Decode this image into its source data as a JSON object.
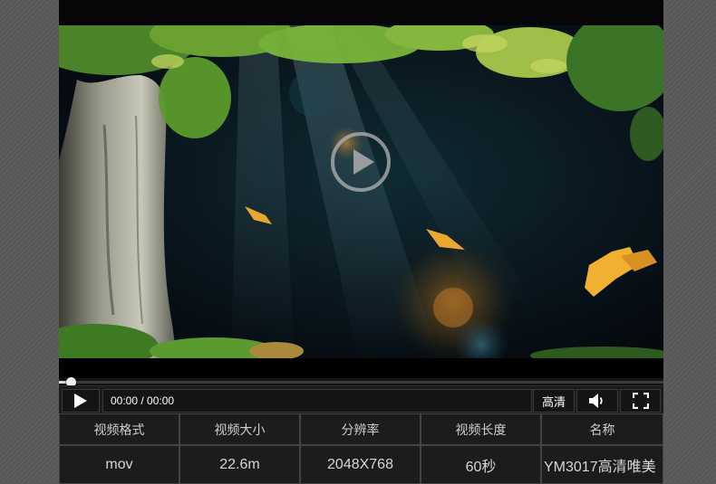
{
  "player": {
    "current_time": "00:00",
    "duration": "00:00",
    "time_display": "00:00 / 00:00",
    "progress": 0.01,
    "quality_label": "高清",
    "icons": {
      "play_overlay": "play-circle-icon",
      "play": "play-icon",
      "volume": "volume-icon",
      "fullscreen": "fullscreen-icon"
    }
  },
  "info_table": {
    "headers": [
      "视频格式",
      "视频大小",
      "分辨率",
      "视频长度",
      "名称"
    ],
    "values": [
      "mov",
      "22.6m",
      "2048X768",
      "60秒",
      "YM3017高清唯美"
    ]
  },
  "colors": {
    "panel_bg": "#0b0b10",
    "control_bg": "#1c1c1e",
    "text": "#cfcfcf"
  }
}
